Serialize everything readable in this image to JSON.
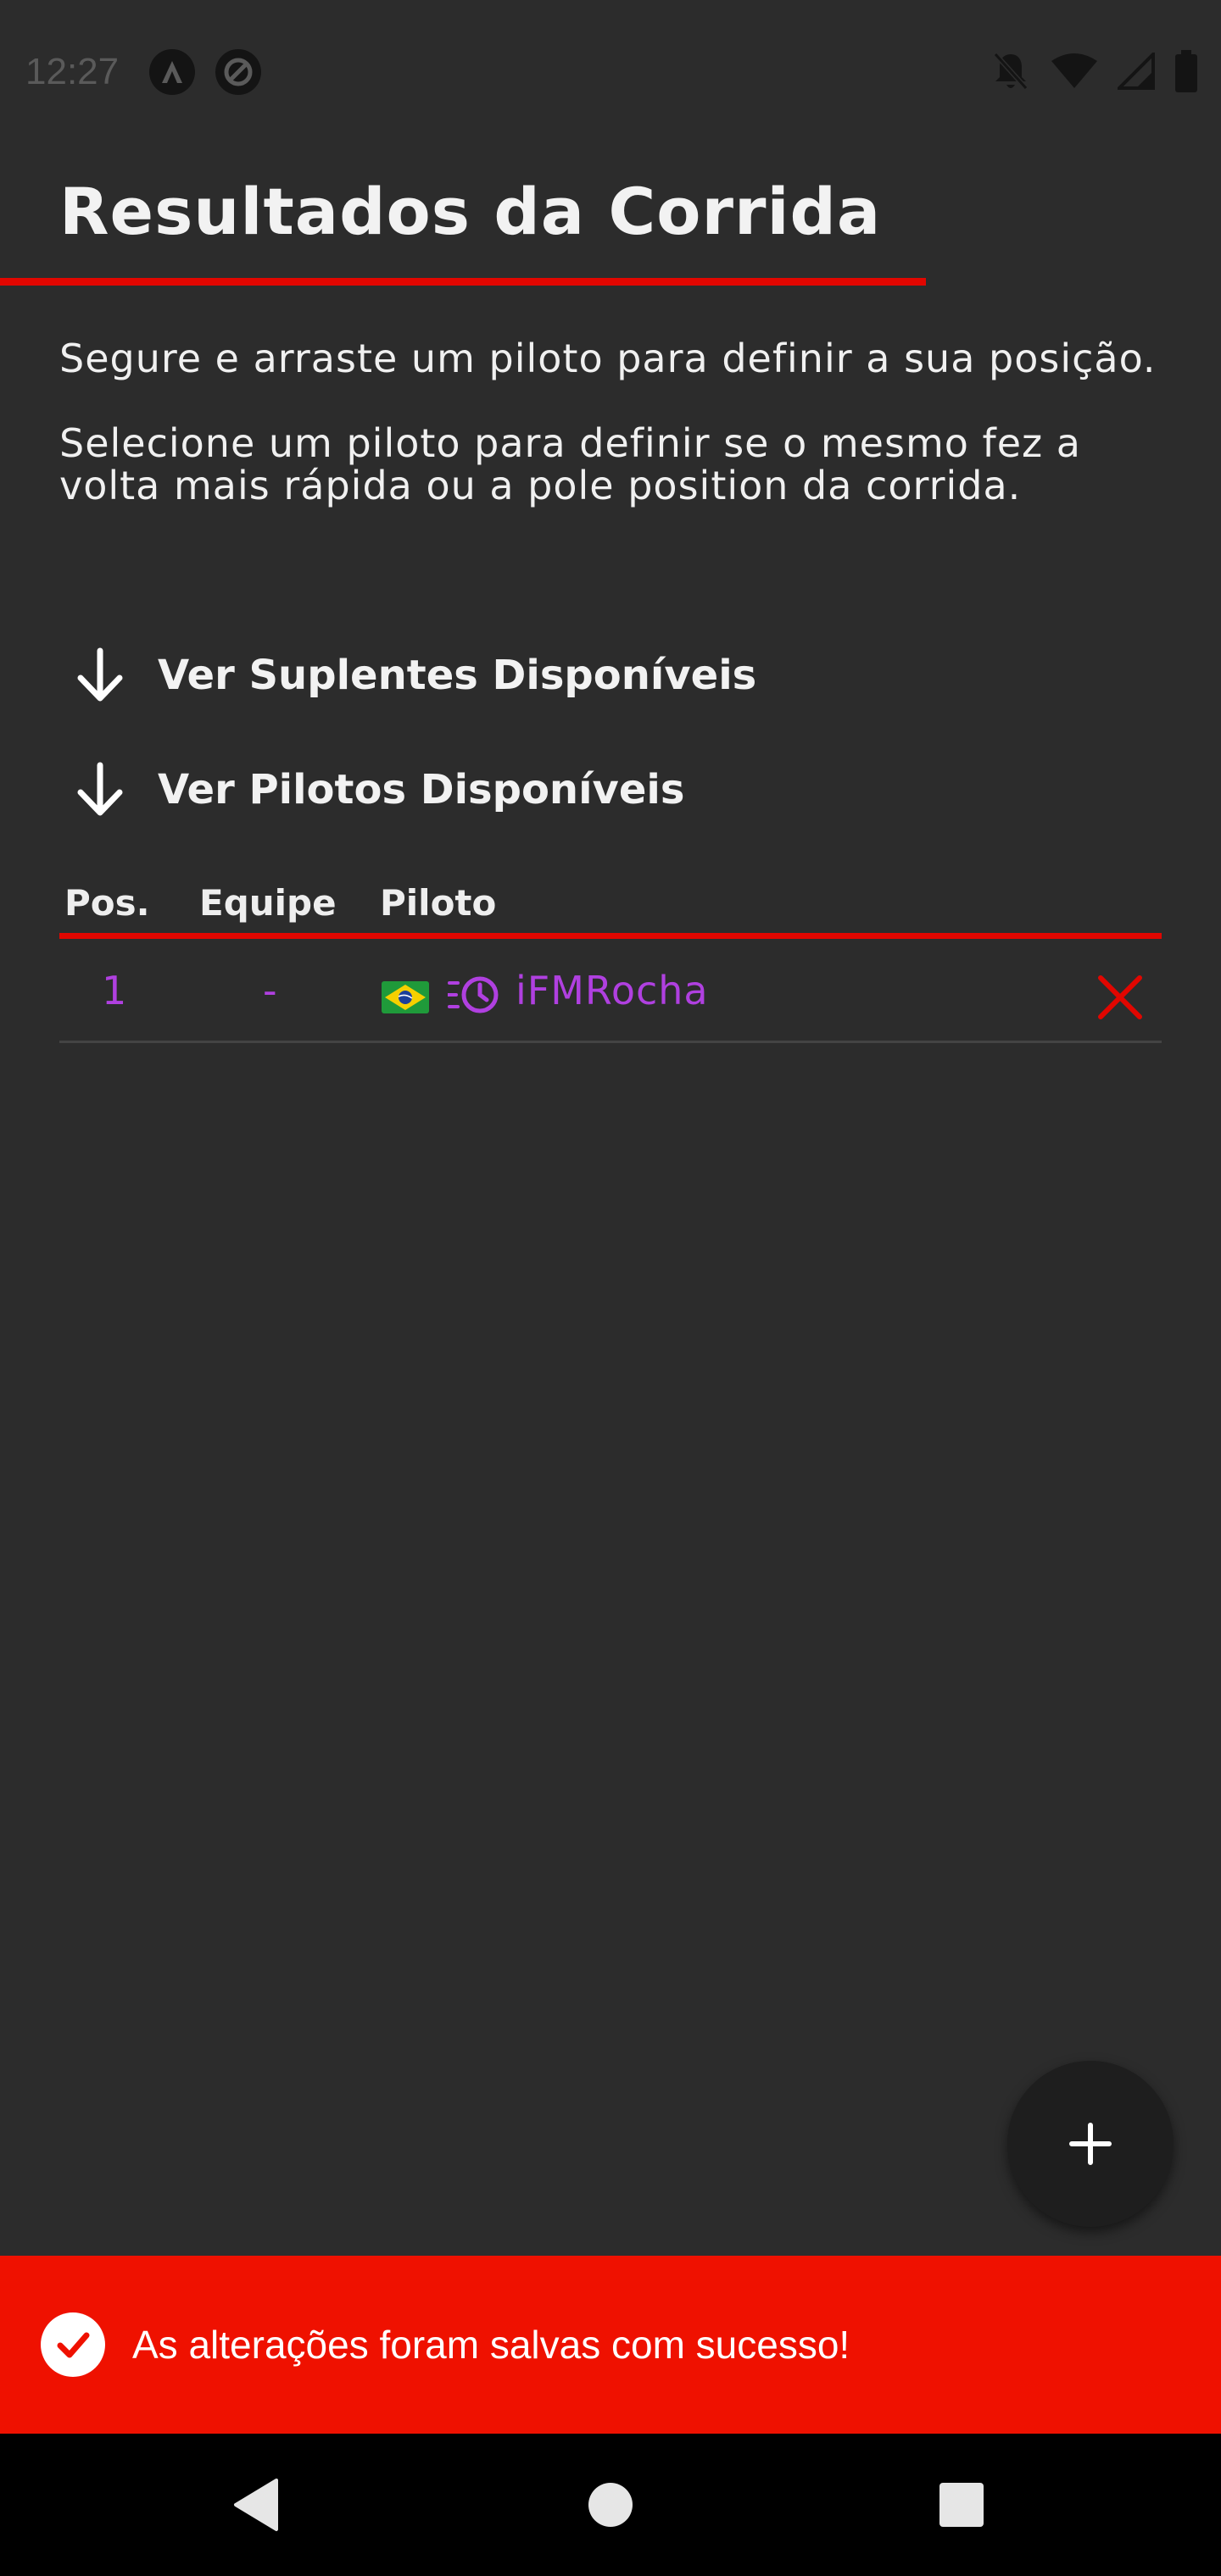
{
  "status_bar": {
    "time": "12:27"
  },
  "header": {
    "title": "Resultados da Corrida"
  },
  "instructions": {
    "line1": "Segure e arraste um piloto para definir a sua posição.",
    "line2": "Selecione um piloto para definir se o mesmo fez a volta mais rápida ou a pole position da corrida."
  },
  "toggles": {
    "substitutes": "Ver Suplentes Disponíveis",
    "drivers": "Ver Pilotos Disponíveis"
  },
  "table": {
    "columns": [
      "Pos.",
      "Equipe",
      "Piloto"
    ],
    "rows": [
      {
        "pos": "1",
        "team": "-",
        "flag": "brazil-flag",
        "badge": "fastest-lap-icon",
        "driver": "iFMRocha"
      }
    ]
  },
  "snackbar": {
    "message": "As alterações foram salvas com sucesso!"
  },
  "colors": {
    "background": "#2c2c2c",
    "accent": "#e10600",
    "highlight": "#b040e0",
    "snackbar": "#ef1100"
  }
}
